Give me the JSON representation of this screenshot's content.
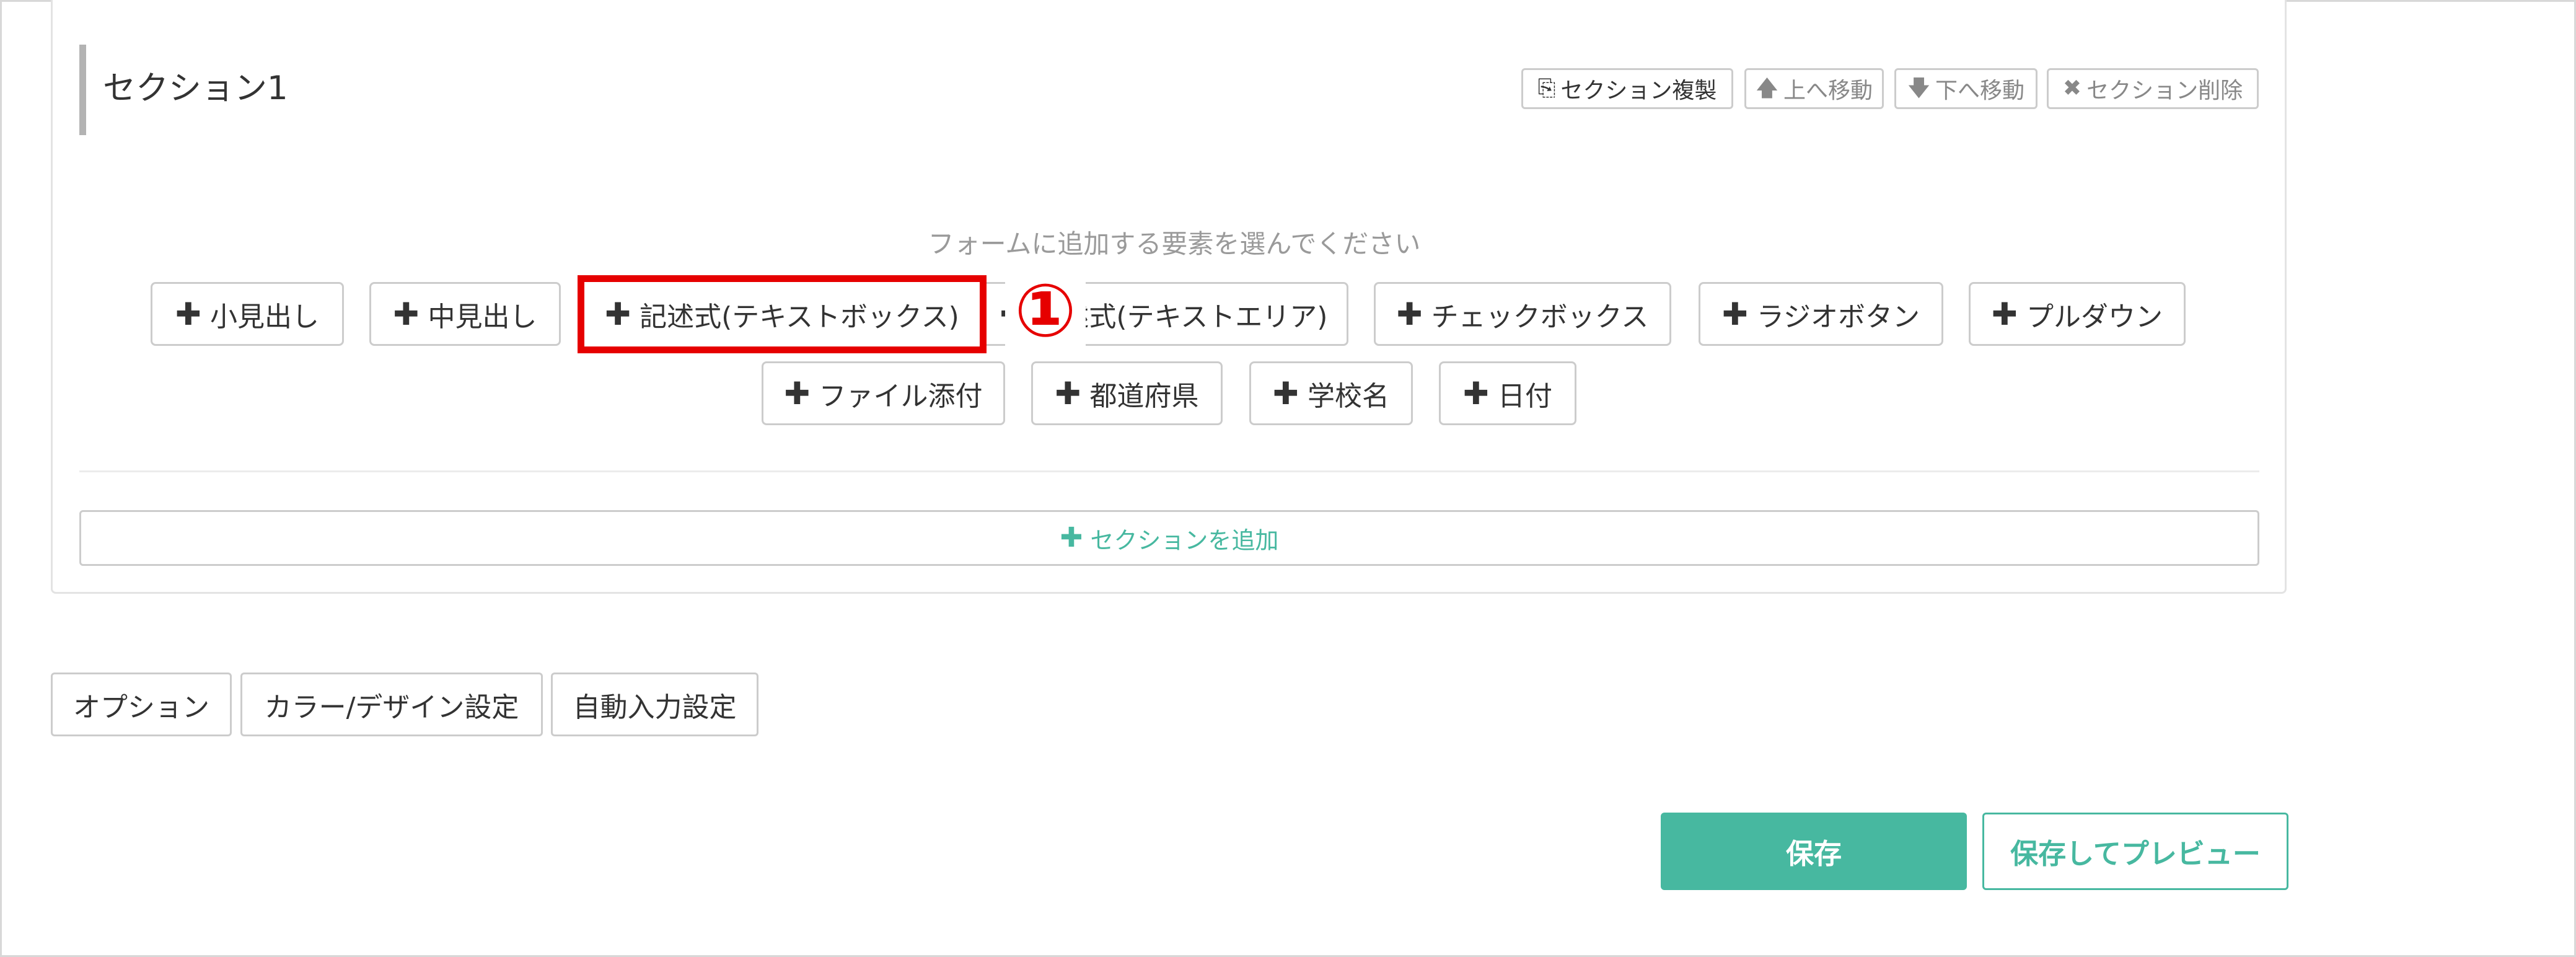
{
  "section": {
    "title": "セクション1",
    "toolbar": [
      {
        "icon": "clipboard-icon",
        "glyph": "⎘",
        "label": "セクション複製"
      },
      {
        "icon": "arrow-up-icon",
        "glyph": "🡅",
        "label": "上へ移動"
      },
      {
        "icon": "arrow-down-icon",
        "glyph": "🡇",
        "label": "下へ移動"
      },
      {
        "icon": "close-icon",
        "glyph": "✖",
        "label": "セクション削除"
      }
    ],
    "hint": "フォームに追加する要素を選んでください",
    "elements_row1": [
      {
        "plus": "✚",
        "label": "小見出し"
      },
      {
        "plus": "✚",
        "label": "中見出し"
      },
      {
        "plus": "✚",
        "label": "記述式(テキストボックス)"
      },
      {
        "plus": "✚",
        "label": "記述式(テキストエリア)"
      },
      {
        "plus": "✚",
        "label": "チェックボックス"
      },
      {
        "plus": "✚",
        "label": "ラジオボタン"
      },
      {
        "plus": "✚",
        "label": "プルダウン"
      }
    ],
    "elements_row2": [
      {
        "plus": "✚",
        "label": "ファイル添付"
      },
      {
        "plus": "✚",
        "label": "都道府県"
      },
      {
        "plus": "✚",
        "label": "学校名"
      },
      {
        "plus": "✚",
        "label": "日付"
      }
    ],
    "annotation_marker": "①",
    "add_section": {
      "plus": "✚",
      "label": "セクションを追加"
    }
  },
  "options": [
    {
      "label": "オプション"
    },
    {
      "label": "カラー/デザイン設定"
    },
    {
      "label": "自動入力設定"
    }
  ],
  "actions": {
    "save": "保存",
    "save_preview": "保存してプレビュー"
  },
  "colors": {
    "accent": "#47b8a0",
    "highlight": "#e60000"
  }
}
